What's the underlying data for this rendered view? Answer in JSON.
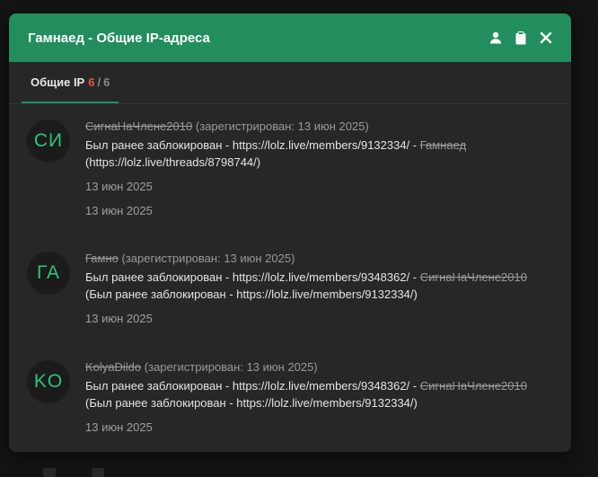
{
  "modal": {
    "title": "Гамнаед - Общие IP-адреса",
    "icons": [
      "user-icon",
      "clipboard-icon",
      "close-icon"
    ]
  },
  "tab": {
    "label": "Общие IP",
    "count": "6",
    "separator": "/",
    "total": "6"
  },
  "entries": [
    {
      "avatar": "СИ",
      "username": "СигнаНаЧлене2010",
      "reg_prefix": "(зарегистрирован: ",
      "reg_date": "13 июн 2025",
      "reg_suffix": ")",
      "desc_part1": "Был ранее заблокирован - https://lolz.live/members/9132334/ - ",
      "desc_strike": "Гамнаед",
      "desc_part2": "(https://lolz.live/threads/8798744/)",
      "dates": [
        "13 июн 2025",
        "13 июн 2025"
      ]
    },
    {
      "avatar": "ГА",
      "username": "Гамно",
      "reg_prefix": "(зарегистрирован: ",
      "reg_date": "13 июн 2025",
      "reg_suffix": ")",
      "desc_part1": "Был ранее заблокирован - https://lolz.live/members/9348362/ - ",
      "desc_strike": "СигнаНаЧлене2010",
      "desc_part2": "(Был ранее заблокирован - https://lolz.live/members/9132334/)",
      "dates": [
        "13 июн 2025"
      ]
    },
    {
      "avatar": "KO",
      "username": "KolyaDildo",
      "reg_prefix": "(зарегистрирован: ",
      "reg_date": "13 июн 2025",
      "reg_suffix": ")",
      "desc_part1": "Был ранее заблокирован - https://lolz.live/members/9348362/ - ",
      "desc_strike": "СигнаНаЧлене2010",
      "desc_part2": "(Был ранее заблокирован - https://lolz.live/members/9132334/)",
      "dates": [
        "13 июн 2025"
      ]
    }
  ]
}
